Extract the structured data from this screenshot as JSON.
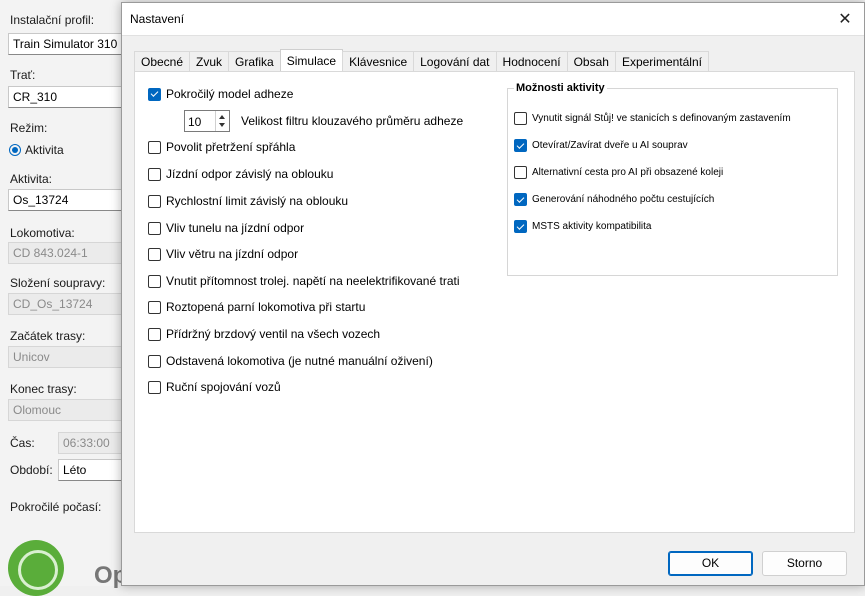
{
  "background": {
    "labels": {
      "profile": "Instalační profil:",
      "route": "Trať:",
      "mode": "Režim:",
      "activity": "Aktivita:",
      "locomotive": "Lokomotiva:",
      "consist": "Složení soupravy:",
      "start": "Začátek trasy:",
      "end": "Konec trasy:",
      "time": "Čas:",
      "season": "Období:",
      "weather": "Pokročilé počasí:"
    },
    "values": {
      "profile": "Train Simulator 310",
      "route": "CR_310",
      "mode": "Aktivita",
      "activity": "Os_13724",
      "locomotive": "CD 843.024-1",
      "consist": "CD_Os_13724",
      "start": "Unicov",
      "end": "Olomouc",
      "time": "06:33:00",
      "season": "Léto"
    },
    "logo_text": "Op"
  },
  "dialog": {
    "title": "Nastavení",
    "tabs": [
      "Obecné",
      "Zvuk",
      "Grafika",
      "Simulace",
      "Klávesnice",
      "Logování dat",
      "Hodnocení",
      "Obsah",
      "Experimentální"
    ],
    "active_tab": "Simulace",
    "options": [
      {
        "label": "Pokročilý model adheze",
        "checked": true
      },
      {
        "label": "Povolit přetržení spřáhla",
        "checked": false
      },
      {
        "label": "Jízdní odpor závislý na oblouku",
        "checked": false
      },
      {
        "label": "Rychlostní limit závislý na oblouku",
        "checked": false
      },
      {
        "label": "Vliv tunelu na jízdní odpor",
        "checked": false
      },
      {
        "label": "Vliv větru na jízdní odpor",
        "checked": false
      },
      {
        "label": "Vnutit přítomnost trolej. napětí na neelektrifikované trati",
        "checked": false
      },
      {
        "label": "Roztopená parní lokomotiva při startu",
        "checked": false
      },
      {
        "label": "Přídržný brzdový ventil na všech vozech",
        "checked": false
      },
      {
        "label": "Odstavená lokomotiva (je nutné manuální oživení)",
        "checked": false
      },
      {
        "label": "Ruční spojování vozů",
        "checked": false
      }
    ],
    "adhesion_filter": {
      "value": "10",
      "label": "Velikost filtru klouzavého průměru adheze"
    },
    "activity_group": {
      "title": "Možnosti aktivity",
      "options": [
        {
          "label": "Vynutit signál Stůj! ve stanicích s definovaným zastavením",
          "checked": false
        },
        {
          "label": "Otevírat/Zavírat dveře u AI souprav",
          "checked": true
        },
        {
          "label": "Alternativní cesta pro AI při obsazené koleji",
          "checked": false
        },
        {
          "label": "Generování náhodného počtu cestujících",
          "checked": true
        },
        {
          "label": "MSTS aktivity kompatibilita",
          "checked": true
        }
      ]
    },
    "ok_label": "OK",
    "cancel_label": "Storno"
  }
}
